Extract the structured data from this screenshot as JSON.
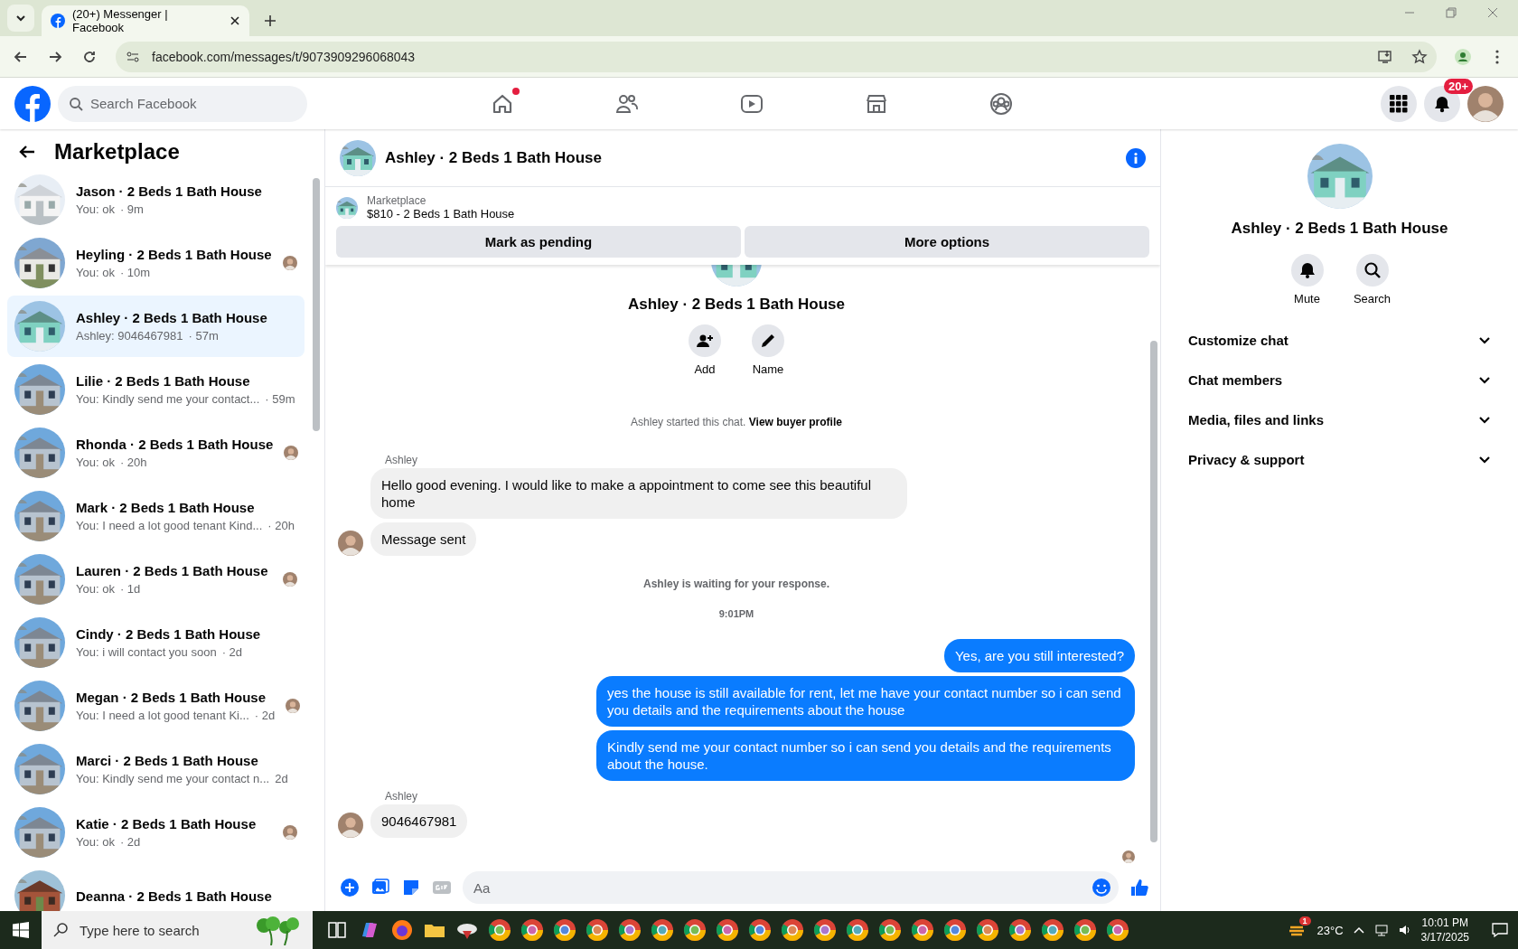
{
  "browser": {
    "tab_title": "(20+) Messenger | Facebook",
    "url": "facebook.com/messages/t/9073909296068043"
  },
  "header": {
    "search_placeholder": "Search Facebook",
    "notification_badge": "20+",
    "nav": [
      {
        "kind": "home",
        "dot": true
      },
      {
        "kind": "friends",
        "dot": false
      },
      {
        "kind": "video",
        "dot": false
      },
      {
        "kind": "marketplace",
        "dot": false
      },
      {
        "kind": "groups",
        "dot": false
      }
    ]
  },
  "sidebar": {
    "title": "Marketplace",
    "conversations": [
      {
        "name": "Jason · 2 Beds 1 Bath House",
        "preview": "You: ok",
        "time": "· 9m",
        "seen": false,
        "selected": false
      },
      {
        "name": "Heyling · 2 Beds 1 Bath House",
        "preview": "You: ok",
        "time": "· 10m",
        "seen": true,
        "selected": false
      },
      {
        "name": "Ashley · 2 Beds 1 Bath House",
        "preview": "Ashley: 9046467981",
        "time": "· 57m",
        "seen": false,
        "selected": true
      },
      {
        "name": "Lilie · 2 Beds 1 Bath House",
        "preview": "You: Kindly send me your contact...",
        "time": "· 59m",
        "seen": false,
        "selected": false
      },
      {
        "name": "Rhonda · 2 Beds 1 Bath House",
        "preview": "You: ok",
        "time": "· 20h",
        "seen": true,
        "selected": false
      },
      {
        "name": "Mark · 2 Beds 1 Bath House",
        "preview": "You: I need a lot good tenant Kind...",
        "time": "· 20h",
        "seen": false,
        "selected": false
      },
      {
        "name": "Lauren · 2 Beds 1 Bath House",
        "preview": "You: ok",
        "time": "· 1d",
        "seen": true,
        "selected": false
      },
      {
        "name": "Cindy · 2 Beds 1 Bath House",
        "preview": "You: i will contact you soon",
        "time": "· 2d",
        "seen": false,
        "selected": false
      },
      {
        "name": "Megan · 2 Beds 1 Bath House",
        "preview": "You: I need a lot good tenant Ki...",
        "time": "· 2d",
        "seen": true,
        "selected": false
      },
      {
        "name": "Marci · 2 Beds 1 Bath House",
        "preview": "You: Kindly send me your contact n...",
        "time": "2d",
        "seen": false,
        "selected": false
      },
      {
        "name": "Katie · 2 Beds 1 Bath House",
        "preview": "You: ok",
        "time": "· 2d",
        "seen": true,
        "selected": false
      },
      {
        "name": "Deanna · 2 Beds 1 Bath House",
        "seen": false,
        "selected": false
      }
    ]
  },
  "chat": {
    "title": "Ashley · 2 Beds 1 Bath House",
    "listing": {
      "label": "Marketplace",
      "title": "$810 - 2 Beds 1 Bath House"
    },
    "actions": [
      "Mark as pending",
      "More options"
    ],
    "intro": {
      "title": "Ashley · 2 Beds 1 Bath House",
      "buttons": [
        {
          "kind": "add",
          "label": "Add"
        },
        {
          "kind": "name",
          "label": "Name"
        }
      ],
      "started": "Ashley started this chat.",
      "link": "View buyer profile"
    },
    "messages": [
      {
        "kind": "sender",
        "text": "Ashley"
      },
      {
        "kind": "incoming",
        "text": "Hello good evening.  I would like to make a appointment to come see this beautiful home",
        "avatar": false
      },
      {
        "kind": "incoming",
        "text": "Message sent",
        "avatar": true
      },
      {
        "kind": "notice",
        "text": "Ashley is waiting for your response."
      },
      {
        "kind": "time",
        "text": "9:01PM"
      },
      {
        "kind": "outgoing",
        "text": "Yes, are you still interested?"
      },
      {
        "kind": "outgoing",
        "text": "yes the house is still available for rent, let me have your contact number so i can send you details and the requirements about the house"
      },
      {
        "kind": "outgoing",
        "text": "Kindly send me your contact number so i can send you details and the requirements about the house."
      },
      {
        "kind": "sender",
        "text": "Ashley"
      },
      {
        "kind": "incoming",
        "text": "9046467981",
        "avatar": true
      }
    ],
    "read_receipt": true,
    "composer": {
      "placeholder": "Aa"
    }
  },
  "details": {
    "title": "Ashley · 2 Beds 1 Bath House",
    "actions": [
      {
        "kind": "mute",
        "label": "Mute"
      },
      {
        "kind": "search",
        "label": "Search"
      }
    ],
    "sections": [
      {
        "label": "Customize chat",
        "expanded": false
      },
      {
        "label": "Chat members",
        "expanded": false
      },
      {
        "label": "Media, files and links",
        "expanded": false
      },
      {
        "label": "Privacy & support",
        "expanded": false
      }
    ]
  },
  "taskbar": {
    "search_placeholder": "Type here to search",
    "weather": "23°C",
    "weather_badge": "1",
    "time": "10:01 PM",
    "date": "3/17/2025"
  }
}
